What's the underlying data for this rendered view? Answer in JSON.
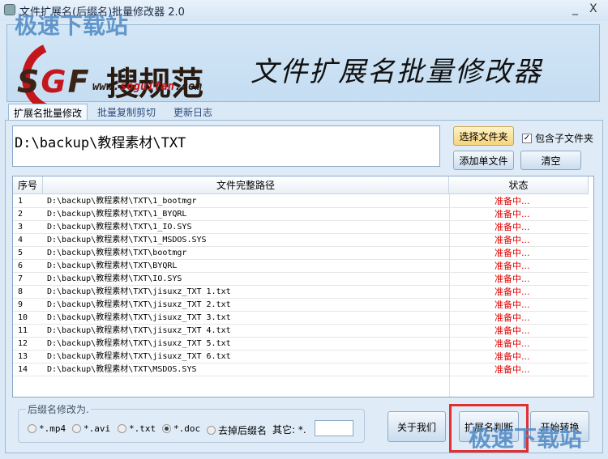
{
  "window": {
    "title": "文件扩展名(后缀名)批量修改器 2.0",
    "minimize": "_",
    "close": "X"
  },
  "banner": {
    "logo_s": "S",
    "logo_g": "G",
    "logo_f": "F",
    "brand": "搜规范",
    "url_prefix": "www.",
    "url_domain": "soguifan",
    "url_suffix": ".com",
    "slogan": "文件扩展名批量修改器"
  },
  "watermark": "极速下载站",
  "tabs": [
    {
      "label": "扩展名批量修改",
      "active": true
    },
    {
      "label": "批量复制剪切"
    },
    {
      "label": "更新日志"
    }
  ],
  "path_input": {
    "value": "D:\\backup\\教程素材\\TXT"
  },
  "buttons": {
    "choose_folder": "选择文件夹",
    "add_file": "添加单文件",
    "clear": "清空",
    "about": "关于我们",
    "detect": "扩展名判断",
    "start": "开始转换"
  },
  "include_subfolders": {
    "label": "包含子文件夹",
    "checked": true
  },
  "table": {
    "columns": [
      "序号",
      "文件完整路径",
      "状态"
    ],
    "rows": [
      {
        "no": "1",
        "path": "D:\\backup\\教程素材\\TXT\\1_bootmgr",
        "status": "准备中..."
      },
      {
        "no": "2",
        "path": "D:\\backup\\教程素材\\TXT\\1_BYQRL",
        "status": "准备中..."
      },
      {
        "no": "3",
        "path": "D:\\backup\\教程素材\\TXT\\1_IO.SYS",
        "status": "准备中..."
      },
      {
        "no": "4",
        "path": "D:\\backup\\教程素材\\TXT\\1_MSDOS.SYS",
        "status": "准备中..."
      },
      {
        "no": "5",
        "path": "D:\\backup\\教程素材\\TXT\\bootmgr",
        "status": "准备中..."
      },
      {
        "no": "6",
        "path": "D:\\backup\\教程素材\\TXT\\BYQRL",
        "status": "准备中..."
      },
      {
        "no": "7",
        "path": "D:\\backup\\教程素材\\TXT\\IO.SYS",
        "status": "准备中..."
      },
      {
        "no": "8",
        "path": "D:\\backup\\教程素材\\TXT\\jisuxz_TXT 1.txt",
        "status": "准备中..."
      },
      {
        "no": "9",
        "path": "D:\\backup\\教程素材\\TXT\\jisuxz_TXT 2.txt",
        "status": "准备中..."
      },
      {
        "no": "10",
        "path": "D:\\backup\\教程素材\\TXT\\jisuxz_TXT 3.txt",
        "status": "准备中..."
      },
      {
        "no": "11",
        "path": "D:\\backup\\教程素材\\TXT\\jisuxz_TXT 4.txt",
        "status": "准备中..."
      },
      {
        "no": "12",
        "path": "D:\\backup\\教程素材\\TXT\\jisuxz_TXT 5.txt",
        "status": "准备中..."
      },
      {
        "no": "13",
        "path": "D:\\backup\\教程素材\\TXT\\jisuxz_TXT 6.txt",
        "status": "准备中..."
      },
      {
        "no": "14",
        "path": "D:\\backup\\教程素材\\TXT\\MSDOS.SYS",
        "status": "准备中..."
      }
    ]
  },
  "suffix_group": {
    "label": "后缀名修改为.",
    "options": [
      {
        "label": "*.mp4"
      },
      {
        "label": "*.avi"
      },
      {
        "label": "*.txt"
      },
      {
        "label": "*.doc",
        "selected": true
      },
      {
        "label": "去掉后缀名"
      }
    ],
    "other_label": "其它: *.",
    "other_value": ""
  },
  "colors": {
    "status": "#e00000",
    "highlight_box": "#e03030"
  }
}
